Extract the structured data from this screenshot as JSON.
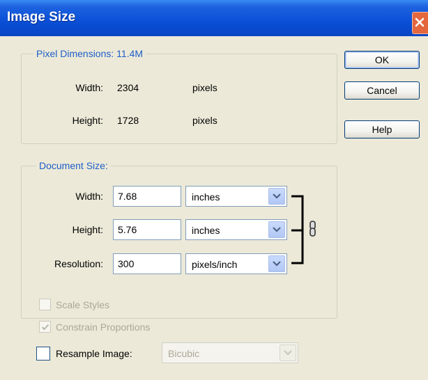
{
  "window": {
    "title": "Image Size"
  },
  "pixel_dimensions": {
    "label": "Pixel Dimensions:",
    "size": "11.4M",
    "width_label": "Width:",
    "width_value": "2304",
    "width_unit": "pixels",
    "height_label": "Height:",
    "height_value": "1728",
    "height_unit": "pixels"
  },
  "document_size": {
    "label": "Document Size:",
    "width_label": "Width:",
    "width_value": "7.68",
    "width_unit": "inches",
    "height_label": "Height:",
    "height_value": "5.76",
    "height_unit": "inches",
    "resolution_label": "Resolution:",
    "resolution_value": "300",
    "resolution_unit": "pixels/inch"
  },
  "buttons": {
    "ok": "OK",
    "cancel": "Cancel",
    "help": "Help"
  },
  "options": {
    "scale_styles": {
      "label": "Scale Styles",
      "checked": false,
      "enabled": false
    },
    "constrain_proportions": {
      "label": "Constrain Proportions",
      "checked": true,
      "enabled": false
    },
    "resample_image": {
      "label": "Resample Image:",
      "checked": false,
      "enabled": true
    },
    "resample_method": {
      "value": "Bicubic",
      "enabled": false
    }
  },
  "colors": {
    "title_bar": "#0a4fd6",
    "group_title": "#1f5fc9",
    "dialog_bg": "#ece9d8",
    "close_button": "#e4673e"
  },
  "icons": {
    "close": "close-icon",
    "dropdown": "chevron-down-icon",
    "link": "chain-link-icon",
    "check": "checkmark-icon"
  }
}
